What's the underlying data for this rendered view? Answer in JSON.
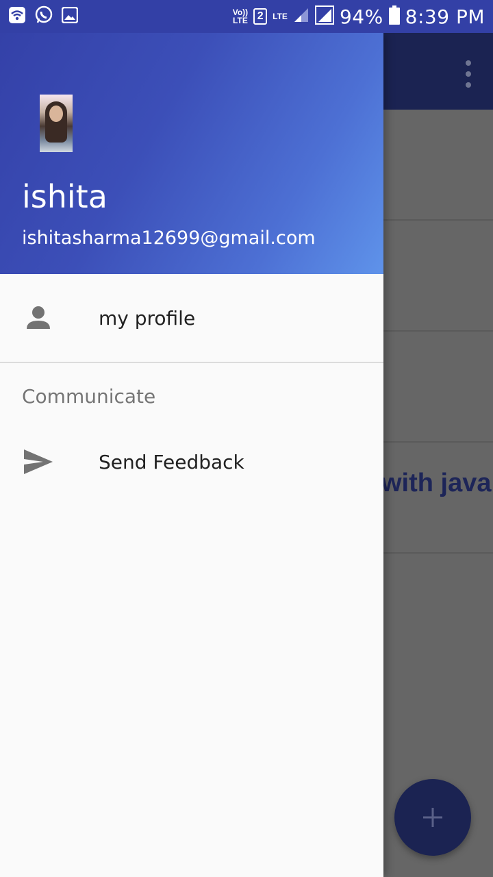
{
  "status_bar": {
    "volte_label": "Vo)) LTE",
    "sim_label": "2",
    "lte_label": "LTE",
    "battery": "94%",
    "time": "8:39 PM"
  },
  "app": {
    "partial_text": "with java",
    "fab_symbol": "+"
  },
  "drawer": {
    "user_name": "ishita",
    "user_email": "ishitasharma12699@gmail.com",
    "items": [
      {
        "label": "my profile",
        "icon": "person-icon"
      }
    ],
    "section_title": "Communicate",
    "section_items": [
      {
        "label": "Send Feedback",
        "icon": "send-icon"
      }
    ]
  },
  "colors": {
    "status_bar": "#3340a6",
    "app_toolbar": "#1b2352",
    "scrim": "#666666",
    "drawer_bg": "#fafafa",
    "header_gradient_start": "#3441a8",
    "header_gradient_end": "#5f93ea"
  }
}
